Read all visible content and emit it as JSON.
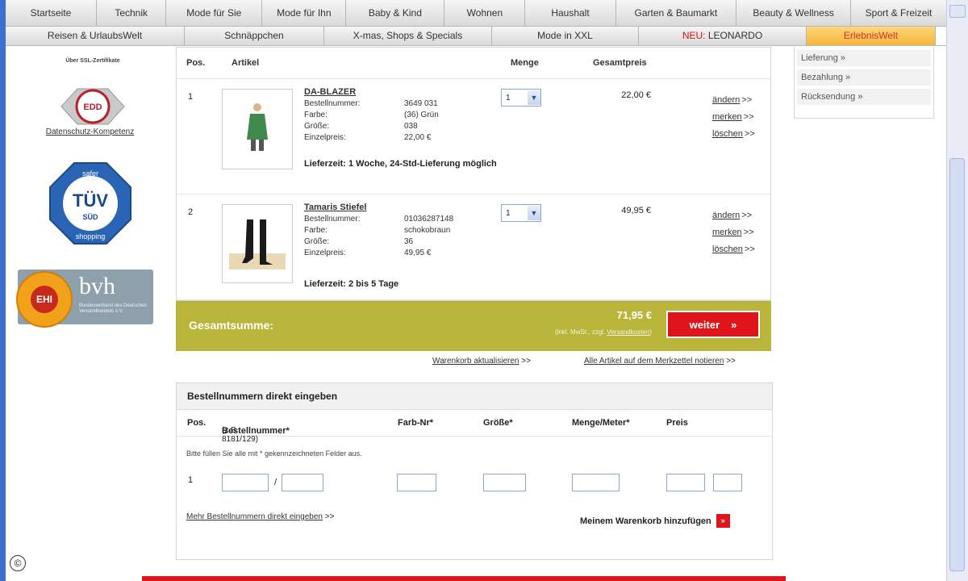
{
  "nav": {
    "row1": [
      "Startseite",
      "Technik",
      "Mode für Sie",
      "Mode für Ihn",
      "Baby & Kind",
      "Wohnen",
      "Haushalt",
      "Garten & Baumarkt",
      "Beauty & Wellness",
      "Sport & Freizeit"
    ],
    "row2": {
      "reisen": "Reisen & UrlaubsWelt",
      "schnaeppchen": "Schnäppchen",
      "xmas": "X-mas, Shops & Specials",
      "xxl": "Mode in XXL",
      "neu_tag": "NEU:",
      "leonardo": "LEONARDO",
      "erlebnis": "ErlebnisWelt"
    }
  },
  "left": {
    "cert_caption": "Über SSL-Zertifikate",
    "edd_logo": "EDD",
    "edd_link": "Datenschutz-Kompetenz",
    "tuv": {
      "top": "safer",
      "main": "TÜV",
      "sub": "SÜD",
      "bottom": "shopping"
    },
    "ehi": "EHI",
    "bvh": "bvh",
    "bvh_sub": "Bundesverband des Deutschen Versandhandels e.V."
  },
  "cart": {
    "headers": {
      "pos": "Pos.",
      "artikel": "Artikel",
      "menge": "Menge",
      "preis": "Gesamtpreis"
    },
    "items": [
      {
        "pos": "1",
        "title": "DA-BLAZER",
        "labels": [
          "Bestellnummer:",
          "Farbe:",
          "Größe:",
          "Einzelpreis:"
        ],
        "values": [
          "3649 031",
          "(36) Grün",
          "038",
          "22,00 €"
        ],
        "lieferzeit": "Lieferzeit: 1 Woche, 24-Std-Lieferung möglich",
        "qty": "1",
        "price": "22,00 €"
      },
      {
        "pos": "2",
        "title": "Tamaris Stiefel",
        "labels": [
          "Bestellnummer:",
          "Farbe:",
          "Größe:",
          "Einzelpreis:"
        ],
        "values": [
          "01036287148",
          "schokobraun",
          "36",
          "49,95 €"
        ],
        "lieferzeit": "Lieferzeit: 2 bis 5 Tage",
        "qty": "1",
        "price": "49,95 €"
      }
    ],
    "actions": {
      "aendern": "ändern",
      "merken": "merken",
      "loeschen": "löschen",
      "arrow": ">>"
    },
    "total": {
      "label": "Gesamtsumme:",
      "amount": "71,95 €",
      "note_pre": "(inkl. MwSt., zzgl. ",
      "note_link": "Versandkosten",
      "note_post": ")",
      "weiter": "weiter",
      "weiter_icon": "»"
    },
    "links": {
      "aktualisieren": "Warenkorb aktualisieren",
      "merkzettel": "Alle Artikel auf dem Merkzettel notieren",
      "arrow": ">>"
    }
  },
  "direct": {
    "title": "Bestellnummern direkt eingeben",
    "cols": {
      "pos": "Pos.",
      "bestell": "Bestellnummer*",
      "hint": "(z.B. 8181/129)",
      "farb": "Farb-Nr*",
      "groesse": "Größe*",
      "menge": "Menge/Meter*",
      "preis": "Preis"
    },
    "note": "Bitte füllen Sie alle mit * gekennzeichneten Felder aus.",
    "row_pos": "1",
    "slash": "/",
    "mehr": "Mehr Bestellnummern direkt eingeben",
    "mehr_arrow": ">>",
    "add": "Meinem Warenkorb hinzufügen",
    "add_icon": "»"
  },
  "right": {
    "items": [
      "Lieferung »",
      "Bezahlung »",
      "Rücksendung »"
    ]
  },
  "copyright": "©"
}
